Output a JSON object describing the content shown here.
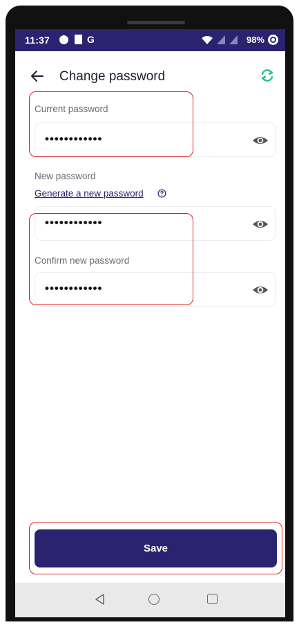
{
  "status_bar": {
    "time": "11:37",
    "carrier_letter": "G",
    "battery": "98%"
  },
  "header": {
    "title": "Change password",
    "back_icon": "arrow-left-icon",
    "refresh_icon": "refresh-icon"
  },
  "fields": {
    "current": {
      "label": "Current password",
      "value": "••••••••••••"
    },
    "new": {
      "label": "New password",
      "value": "••••••••••••"
    },
    "confirm": {
      "label": "Confirm new password",
      "value": "••••••••••••"
    }
  },
  "generate_link": "Generate a new password",
  "save_label": "Save",
  "colors": {
    "primary": "#2a2370",
    "accent": "#1fc28a",
    "highlight": "#dd2222"
  }
}
